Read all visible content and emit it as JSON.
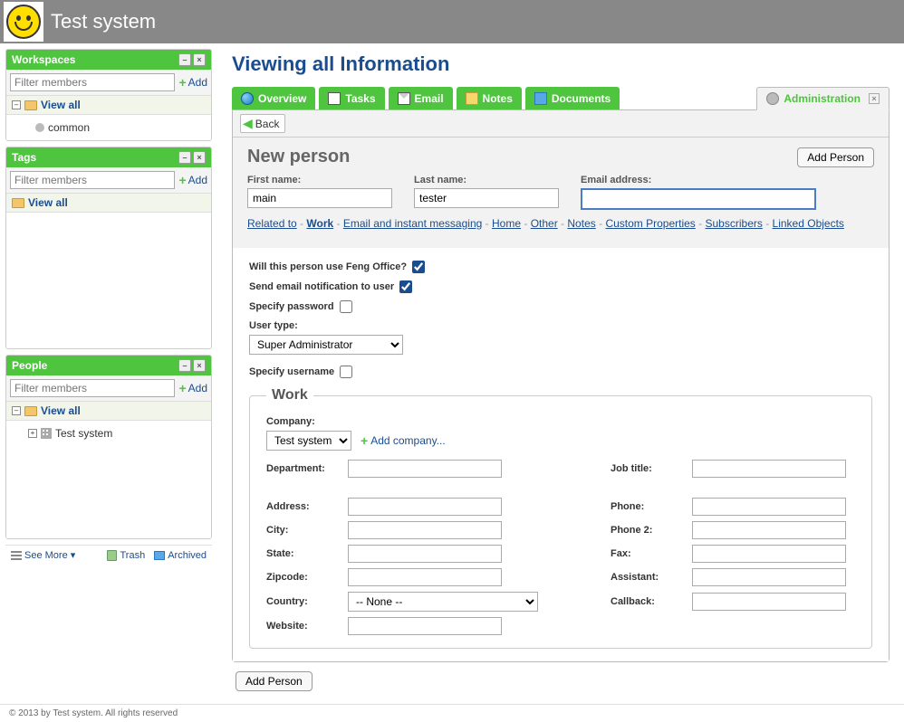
{
  "site_title": "Test system",
  "sidebar": {
    "panels": [
      {
        "title": "Workspaces",
        "filter_placeholder": "Filter members",
        "add": "Add",
        "viewall": "View all",
        "items": [
          {
            "label": "common"
          }
        ]
      },
      {
        "title": "Tags",
        "filter_placeholder": "Filter members",
        "add": "Add",
        "viewall": "View all",
        "items": []
      },
      {
        "title": "People",
        "filter_placeholder": "Filter members",
        "add": "Add",
        "viewall": "View all",
        "items": [
          {
            "label": "Test system"
          }
        ]
      }
    ],
    "bottom": {
      "see_more": "See More",
      "trash": "Trash",
      "archived": "Archived"
    }
  },
  "footer": "© 2013 by Test system. All rights reserved",
  "main": {
    "title": "Viewing all Information",
    "tabs": [
      {
        "label": "Overview"
      },
      {
        "label": "Tasks"
      },
      {
        "label": "Email"
      },
      {
        "label": "Notes"
      },
      {
        "label": "Documents"
      },
      {
        "label": "Administration",
        "active": true
      }
    ],
    "back": "Back",
    "form_title": "New person",
    "add_person": "Add Person",
    "fields": {
      "first_name_label": "First name:",
      "first_name_value": "main",
      "last_name_label": "Last name:",
      "last_name_value": "tester",
      "email_label": "Email address:",
      "email_value": ""
    },
    "link_row": {
      "related_to": "Related to",
      "links": [
        "Work",
        "Email and instant messaging",
        "Home",
        "Other",
        "Notes",
        "Custom Properties",
        "Subscribers",
        "Linked Objects"
      ],
      "active": "Work"
    },
    "options": {
      "feng": "Will this person use Feng Office?",
      "feng_checked": true,
      "notify": "Send email notification to user",
      "notify_checked": true,
      "specify_pw": "Specify password",
      "specify_pw_checked": false,
      "user_type_label": "User type:",
      "user_type_value": "Super Administrator",
      "specify_user": "Specify username",
      "specify_user_checked": false
    },
    "work": {
      "legend": "Work",
      "company_label": "Company:",
      "company_value": "Test system",
      "add_company": "Add company...",
      "left_fields": [
        {
          "label": "Department:",
          "type": "text"
        },
        {
          "label": "Address:",
          "type": "text"
        },
        {
          "label": "City:",
          "type": "text"
        },
        {
          "label": "State:",
          "type": "text"
        },
        {
          "label": "Zipcode:",
          "type": "text"
        },
        {
          "label": "Country:",
          "type": "select",
          "value": "-- None --"
        },
        {
          "label": "Website:",
          "type": "text"
        }
      ],
      "right_fields": [
        {
          "label": "Job title:",
          "type": "text"
        },
        {
          "label": "Phone:",
          "type": "text"
        },
        {
          "label": "Phone 2:",
          "type": "text"
        },
        {
          "label": "Fax:",
          "type": "text"
        },
        {
          "label": "Assistant:",
          "type": "text"
        },
        {
          "label": "Callback:",
          "type": "text"
        }
      ]
    }
  }
}
